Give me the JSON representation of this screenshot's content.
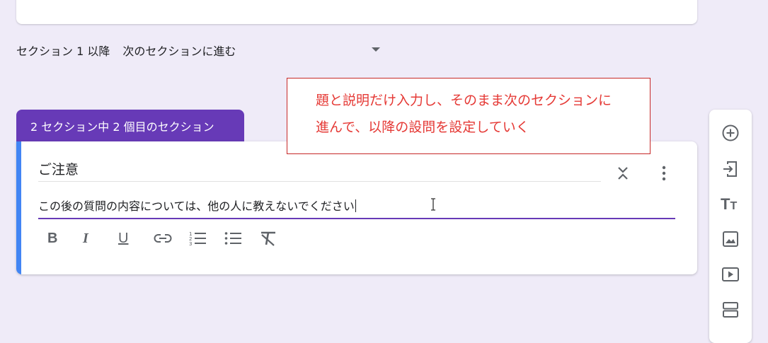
{
  "section_after": {
    "label": "セクション 1 以降",
    "selected_option": "次のセクションに進む"
  },
  "section_tab": {
    "label": "2 セクション中 2 個目のセクション"
  },
  "callout": {
    "line1": "題と説明だけ入力し、そのまま次のセクションに",
    "line2": "進んで、以降の設問を設定していく"
  },
  "card": {
    "title": "ご注意",
    "description": "この後の質問の内容については、他の人に教えないでください",
    "toolbar": {
      "bold_label": "B",
      "italic_label": "I",
      "underline_label": "U"
    }
  },
  "sidebar": {
    "text_label": "T",
    "text_label_small": "T"
  },
  "colors": {
    "accent_purple": "#673ab7",
    "accent_blue": "#4285f4",
    "callout_red": "#e53935",
    "background": "#efebf8"
  }
}
